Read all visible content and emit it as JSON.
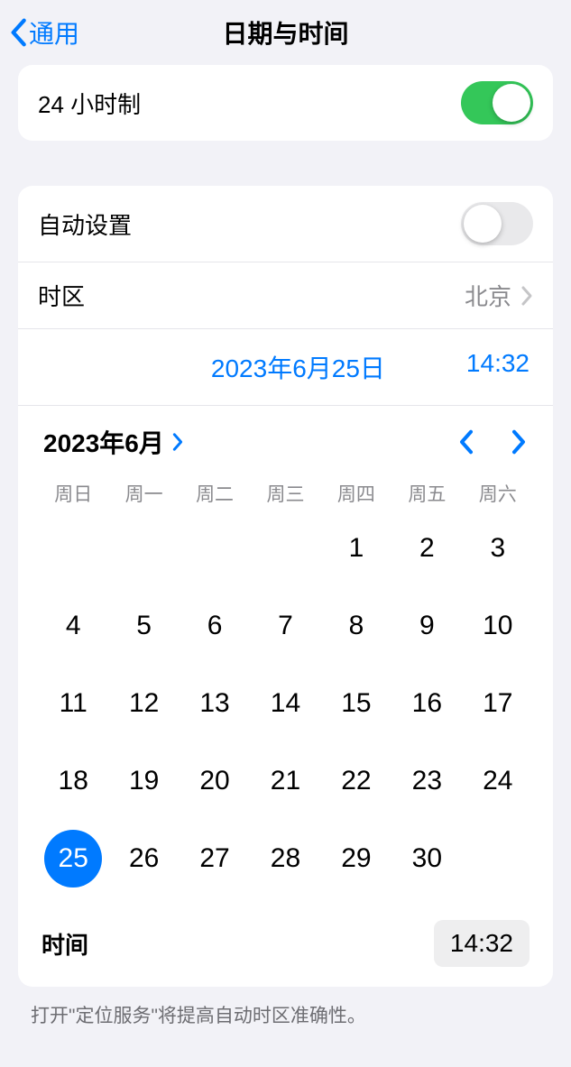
{
  "nav": {
    "back_label": "通用",
    "title": "日期与时间"
  },
  "section1": {
    "hour24_label": "24 小时制",
    "hour24_on": true
  },
  "section2": {
    "auto_label": "自动设置",
    "auto_on": false,
    "timezone_label": "时区",
    "timezone_value": "北京",
    "date_display": "2023年6月25日",
    "time_display": "14:32"
  },
  "calendar": {
    "month_label": "2023年6月",
    "weekdays": [
      "周日",
      "周一",
      "周二",
      "周三",
      "周四",
      "周五",
      "周六"
    ],
    "first_weekday": 4,
    "num_days": 30,
    "selected_day": 25,
    "time_label": "时间",
    "time_value": "14:32"
  },
  "footer": {
    "note": "打开\"定位服务\"将提高自动时区准确性。"
  }
}
